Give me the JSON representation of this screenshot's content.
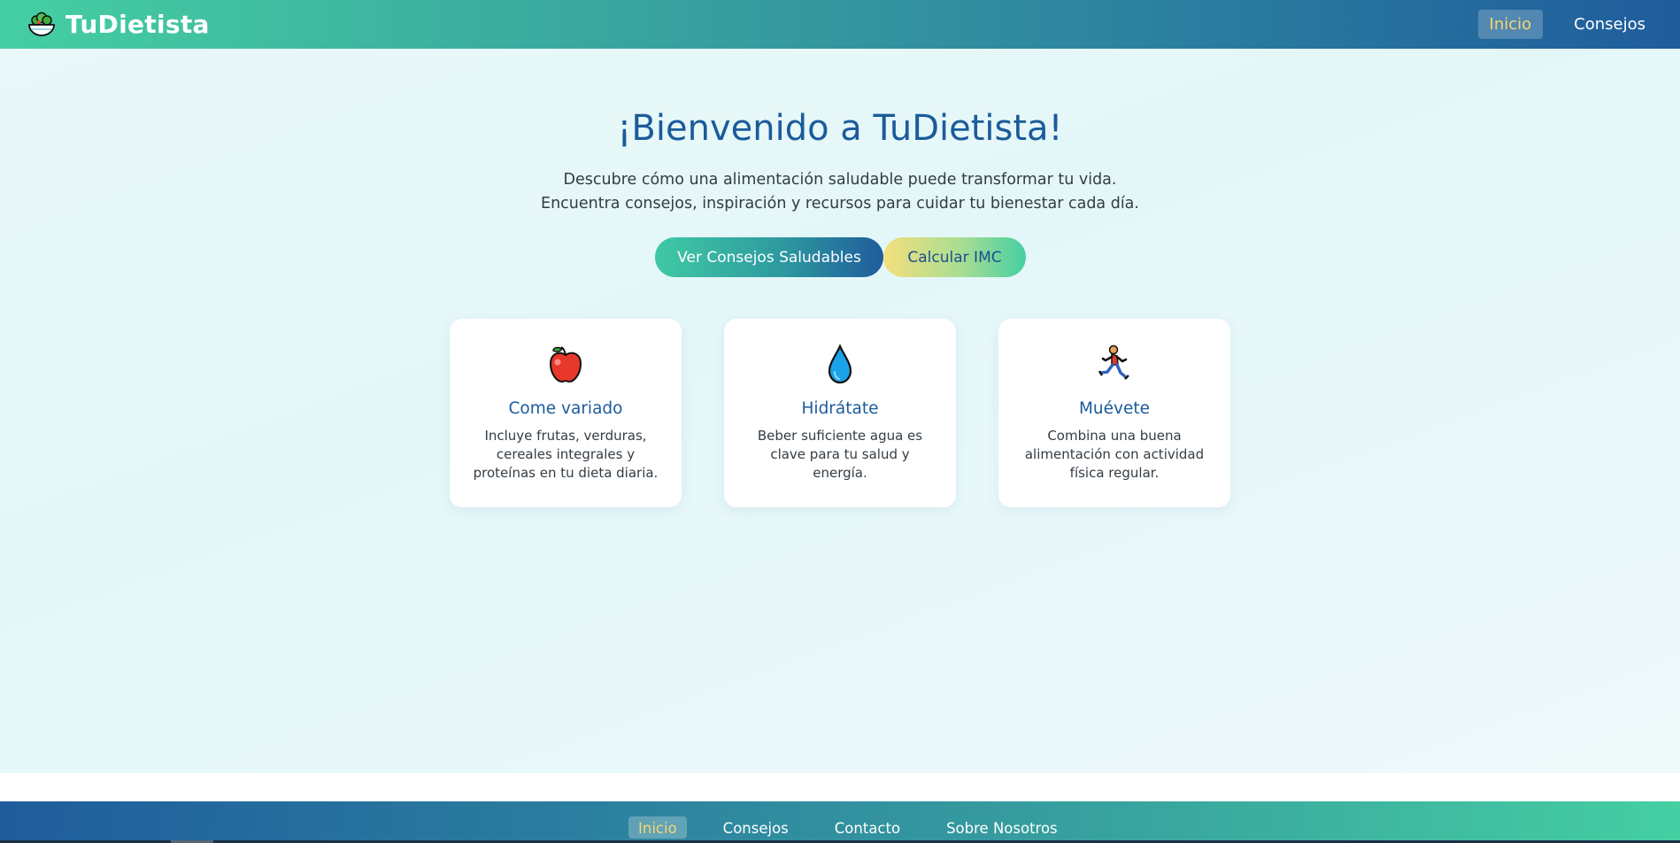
{
  "brand": {
    "name": "TuDietista",
    "logo_icon": "salad-bowl-icon"
  },
  "header_nav": [
    {
      "label": "Inicio",
      "active": true
    },
    {
      "label": "Consejos",
      "active": false
    }
  ],
  "hero": {
    "title": "¡Bienvenido a TuDietista!",
    "subtitle_line1": "Descubre cómo una alimentación saludable puede transformar tu vida.",
    "subtitle_line2": "Encuentra consejos, inspiración y recursos para cuidar tu bienestar cada día.",
    "primary_button": "Ver Consejos Saludables",
    "secondary_button": "Calcular IMC"
  },
  "cards": [
    {
      "icon": "apple-icon",
      "title": "Come variado",
      "text": "Incluye frutas, verduras, cereales integrales y proteínas en tu dieta diaria."
    },
    {
      "icon": "water-drop-icon",
      "title": "Hidrátate",
      "text": "Beber suficiente agua es clave para tu salud y energía."
    },
    {
      "icon": "runner-icon",
      "title": "Muévete",
      "text": "Combina una buena alimentación con actividad física regular."
    }
  ],
  "footer_nav": [
    {
      "label": "Inicio",
      "active": true
    },
    {
      "label": "Consejos",
      "active": false
    },
    {
      "label": "Contacto",
      "active": false
    },
    {
      "label": "Sobre Nosotros",
      "active": false
    }
  ],
  "colors": {
    "primary_blue": "#1b5b9b",
    "mint": "#45cfa2",
    "active_link": "#f5d66e",
    "background": "#e6f7f8"
  }
}
